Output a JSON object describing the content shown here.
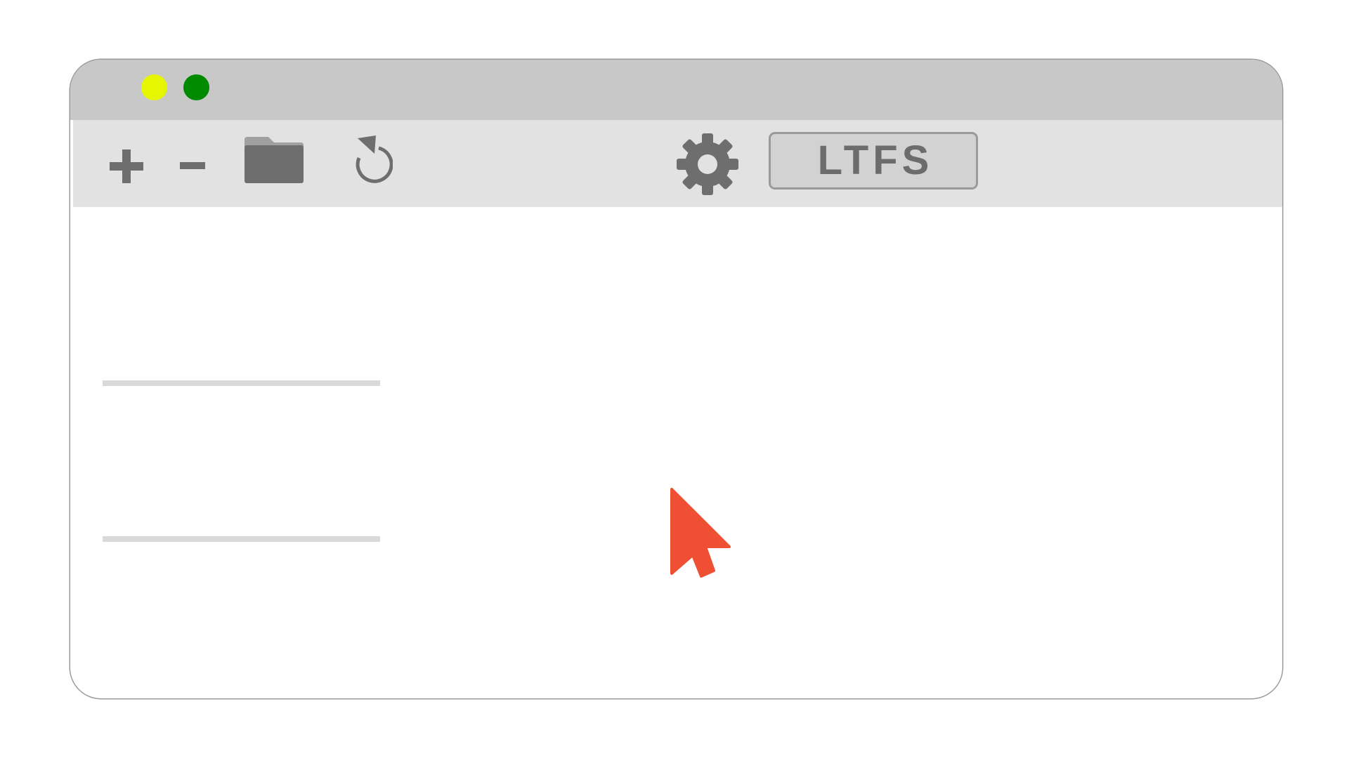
{
  "window": {
    "controls": [
      {
        "name": "minimize",
        "color": "#e6f500"
      },
      {
        "name": "maximize",
        "color": "#008a00"
      }
    ]
  },
  "toolbar": {
    "icons": {
      "add": "plus-icon",
      "remove": "minus-icon",
      "open": "folder-icon",
      "refresh": "reload-icon",
      "settings": "gear-icon"
    },
    "ltfs_label": "LTFS",
    "icon_color": "#6e6e6e"
  },
  "cursor": {
    "icon": "arrow-cursor-icon",
    "color": "#ef4f33"
  }
}
